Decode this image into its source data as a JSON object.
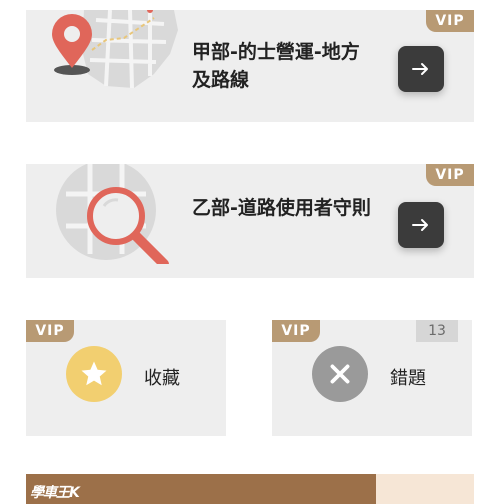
{
  "cards": [
    {
      "title": "甲部-的士營運-地方及路線",
      "badge": "VIP"
    },
    {
      "title": "乙部-道路使用者守則",
      "badge": "VIP"
    }
  ],
  "favorites": {
    "badge": "VIP",
    "label": "收藏"
  },
  "mistakes": {
    "badge": "VIP",
    "label": "錯題",
    "count": "13"
  },
  "banner": {
    "logo_text": "學車王K"
  },
  "colors": {
    "vip_badge": "#b89a74",
    "card_bg": "#eeeeee",
    "arrow_button": "#3b3b3b",
    "star_circle": "#f2cf70",
    "x_circle": "#9a9a9a",
    "pin_red": "#e0665a",
    "banner_bg": "#9c7049"
  },
  "icons": {
    "map_illustration": "map-pin-illustration",
    "road_illustration": "magnifier-map-illustration",
    "arrow": "arrow-right-icon",
    "star": "star-icon",
    "x": "close-icon"
  }
}
